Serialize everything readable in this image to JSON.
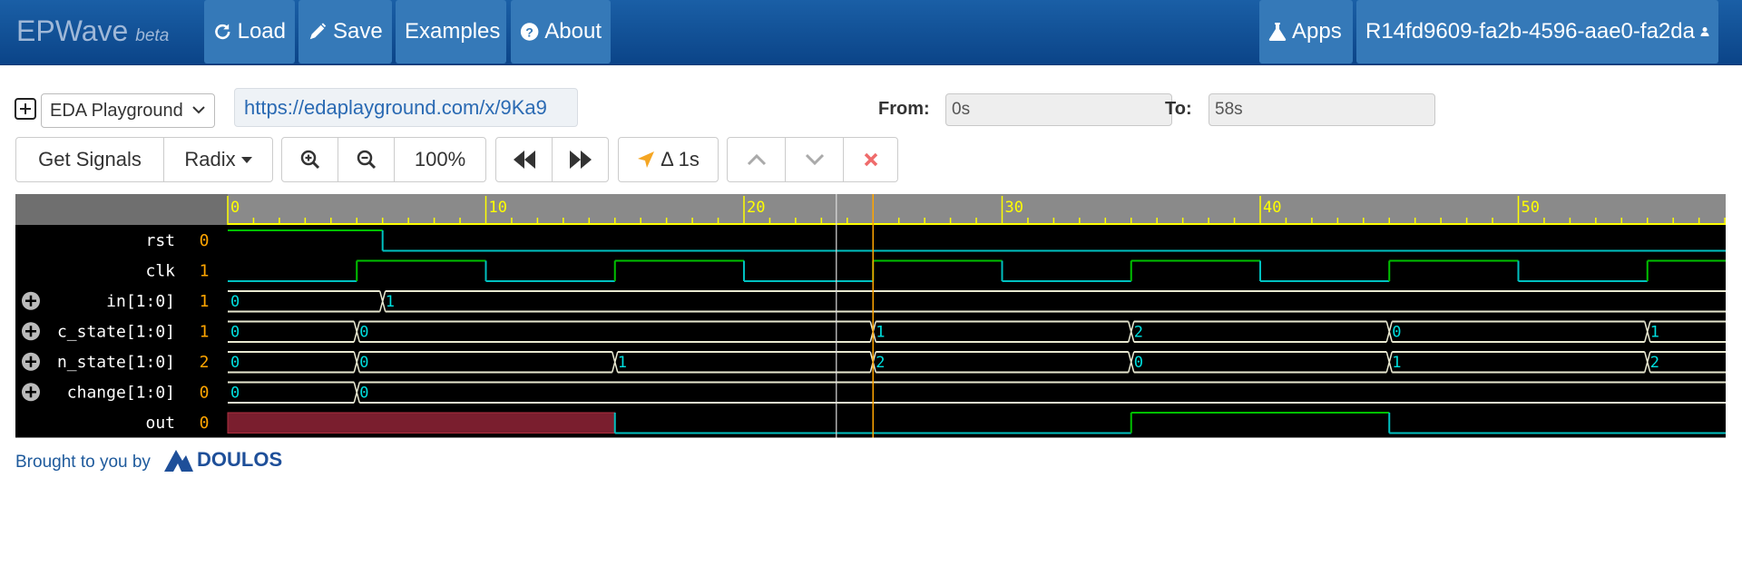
{
  "navbar": {
    "brand": "EPWave",
    "beta": "beta",
    "load": "Load",
    "save": "Save",
    "examples": "Examples",
    "about": "About",
    "apps": "Apps",
    "session": "R14fd9609-fa2b-4596-aae0-fa2da"
  },
  "toolbar1": {
    "playground": "EDA Playground",
    "url": "https://edaplayground.com/x/9Ka9",
    "from_label": "From:",
    "from_value": "0s",
    "to_label": "To:",
    "to_value": "58s"
  },
  "toolbar2": {
    "get_signals": "Get Signals",
    "radix": "Radix",
    "zoom": "100%",
    "delta": "Δ 1s"
  },
  "colors": {
    "navbar": "#0b4488",
    "wave_bg": "#000000",
    "ruler": "#8a8a8a",
    "tick": "#ffff00",
    "value_text": "#00e0e0",
    "high_green": "#00c000",
    "low_cyan": "#00c0c0",
    "bus": "#e8e8d0",
    "x_state": "#7a1e2e",
    "name_value": "#ffa500",
    "cursor": "#ffa500",
    "marker": "#dddddd"
  },
  "wave": {
    "time_end": 58,
    "ruler_labels": [
      "0",
      "10",
      "20",
      "30",
      "40",
      "50"
    ],
    "cursor_time": 25,
    "marker_time": 24,
    "signals": [
      {
        "name": "rst",
        "value": "0",
        "expandable": false,
        "type": "bit",
        "transitions": [
          {
            "t": 0,
            "v": 1
          },
          {
            "t": 6,
            "v": 0
          }
        ]
      },
      {
        "name": "clk",
        "value": "1",
        "expandable": false,
        "type": "bit",
        "transitions": [
          {
            "t": 0,
            "v": 0
          },
          {
            "t": 5,
            "v": 1
          },
          {
            "t": 10,
            "v": 0
          },
          {
            "t": 15,
            "v": 1
          },
          {
            "t": 20,
            "v": 0
          },
          {
            "t": 25,
            "v": 1
          },
          {
            "t": 30,
            "v": 0
          },
          {
            "t": 35,
            "v": 1
          },
          {
            "t": 40,
            "v": 0
          },
          {
            "t": 45,
            "v": 1
          },
          {
            "t": 50,
            "v": 0
          },
          {
            "t": 55,
            "v": 1
          }
        ]
      },
      {
        "name": "in[1:0]",
        "value": "1",
        "expandable": true,
        "type": "bus",
        "transitions": [
          {
            "t": 0,
            "v": "0"
          },
          {
            "t": 6,
            "v": "1"
          }
        ]
      },
      {
        "name": "c_state[1:0]",
        "value": "1",
        "expandable": true,
        "type": "bus",
        "transitions": [
          {
            "t": 0,
            "v": "0"
          },
          {
            "t": 5,
            "v": "0"
          },
          {
            "t": 25,
            "v": "1"
          },
          {
            "t": 35,
            "v": "2"
          },
          {
            "t": 45,
            "v": "0"
          },
          {
            "t": 55,
            "v": "1"
          }
        ]
      },
      {
        "name": "n_state[1:0]",
        "value": "2",
        "expandable": true,
        "type": "bus",
        "transitions": [
          {
            "t": 0,
            "v": "0"
          },
          {
            "t": 5,
            "v": "0"
          },
          {
            "t": 15,
            "v": "1"
          },
          {
            "t": 25,
            "v": "2"
          },
          {
            "t": 35,
            "v": "0"
          },
          {
            "t": 45,
            "v": "1"
          },
          {
            "t": 55,
            "v": "2"
          }
        ]
      },
      {
        "name": "change[1:0]",
        "value": "0",
        "expandable": true,
        "type": "bus",
        "transitions": [
          {
            "t": 0,
            "v": "0"
          },
          {
            "t": 5,
            "v": "0"
          }
        ]
      },
      {
        "name": "out",
        "value": "0",
        "expandable": false,
        "type": "bit",
        "transitions": [
          {
            "t": 0,
            "v": "x"
          },
          {
            "t": 15,
            "v": 0
          },
          {
            "t": 35,
            "v": 1
          },
          {
            "t": 45,
            "v": 0
          }
        ]
      }
    ]
  },
  "footer": {
    "brought": "Brought to you by",
    "logo": "DOULOS"
  }
}
